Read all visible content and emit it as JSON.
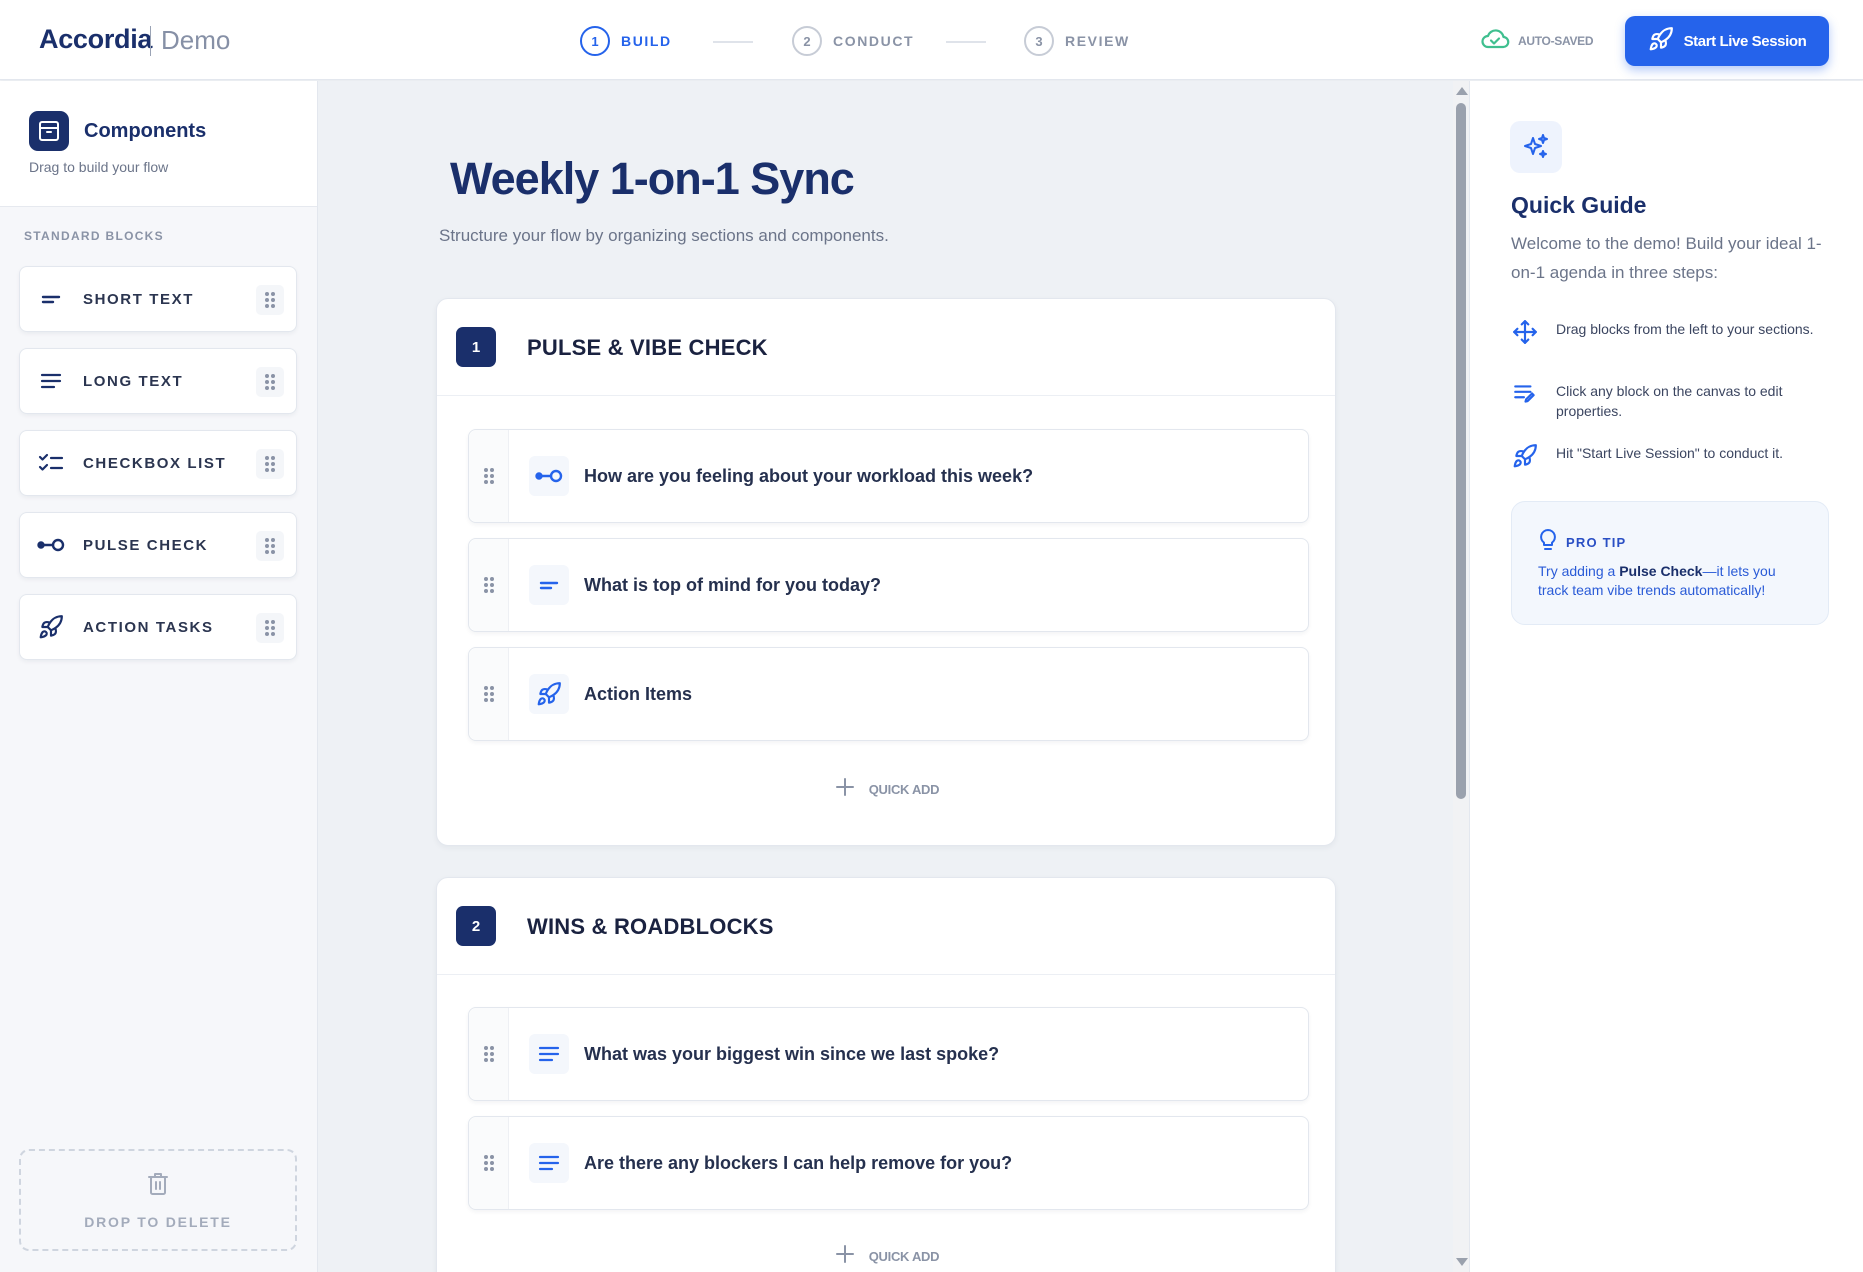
{
  "brand": {
    "name": "Accordia",
    "tag": "Demo"
  },
  "stepper": [
    {
      "num": "1",
      "label": "BUILD",
      "active": true
    },
    {
      "num": "2",
      "label": "CONDUCT",
      "active": false
    },
    {
      "num": "3",
      "label": "REVIEW",
      "active": false
    }
  ],
  "autosave": {
    "label": "AUTO-SAVED",
    "icon": "cloud-check-icon",
    "color": "#3fbf8f"
  },
  "start_button": {
    "label": "Start Live Session",
    "icon": "rocket-icon",
    "color": "#2563eb"
  },
  "sidebar": {
    "title": "Components",
    "subtitle": "Drag to build your flow",
    "section_label": "STANDARD BLOCKS",
    "blocks": [
      {
        "label": "SHORT TEXT",
        "icon": "short-text-icon"
      },
      {
        "label": "LONG TEXT",
        "icon": "long-text-icon"
      },
      {
        "label": "CHECKBOX LIST",
        "icon": "checkbox-list-icon"
      },
      {
        "label": "PULSE CHECK",
        "icon": "pulse-check-icon"
      },
      {
        "label": "ACTION TASKS",
        "icon": "rocket-icon"
      }
    ],
    "trash_label": "DROP TO DELETE"
  },
  "canvas": {
    "title": "Weekly 1-on-1 Sync",
    "subtitle": "Structure your flow by organizing sections and components.",
    "sections": [
      {
        "num": "1",
        "title": "PULSE & VIBE CHECK",
        "items": [
          {
            "text": "How are you feeling about your workload this week?",
            "icon": "pulse-check-icon"
          },
          {
            "text": "What is top of mind for you today?",
            "icon": "short-text-icon"
          },
          {
            "text": "Action Items",
            "icon": "rocket-icon"
          }
        ],
        "quick_add": "QUICK ADD"
      },
      {
        "num": "2",
        "title": "WINS & ROADBLOCKS",
        "items": [
          {
            "text": "What was your biggest win since we last spoke?",
            "icon": "long-text-icon"
          },
          {
            "text": "Are there any blockers I can help remove for you?",
            "icon": "long-text-icon"
          }
        ],
        "quick_add": "QUICK ADD"
      }
    ]
  },
  "guide": {
    "title": "Quick Guide",
    "intro": "Welcome to the demo! Build your ideal 1-on-1 agenda in three steps:",
    "steps": [
      {
        "text": "Drag blocks from the left to your sections.",
        "icon": "move-icon"
      },
      {
        "text": "Click any block on the canvas to edit properties.",
        "icon": "edit-list-icon"
      },
      {
        "text": "Hit \"Start Live Session\" to conduct it.",
        "icon": "rocket-icon"
      }
    ],
    "tip": {
      "label": "PRO TIP",
      "text_before": "Try adding a ",
      "text_bold": "Pulse Check",
      "text_after": "—it lets you track team vibe trends automatically!"
    }
  }
}
